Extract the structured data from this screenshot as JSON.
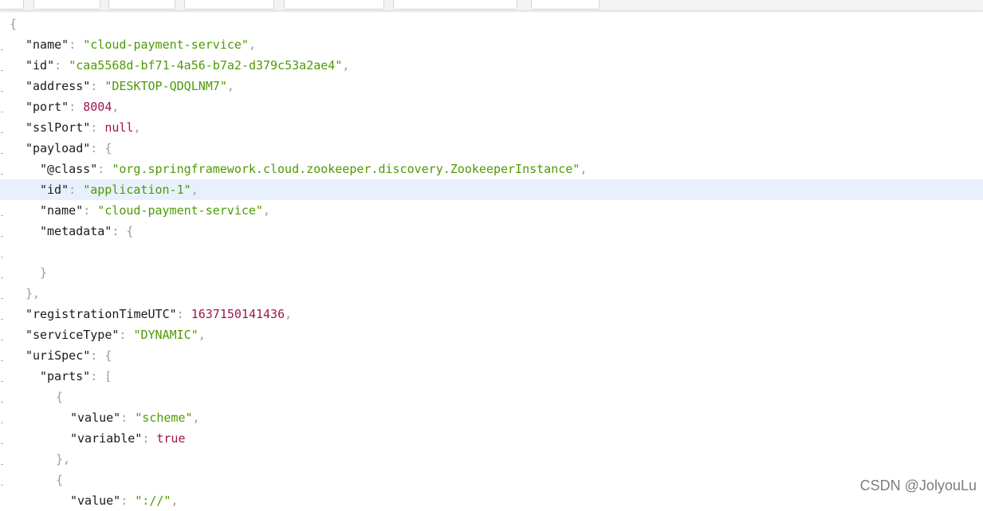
{
  "watermark": "CSDN @JolyouLu",
  "lines": [
    [
      "{"
    ],
    [
      "\"name\"",
      ": ",
      "\"cloud-payment-service\"",
      ","
    ],
    [
      "\"id\"",
      ": ",
      "\"caa5568d-bf71-4a56-b7a2-d379c53a2ae4\"",
      ","
    ],
    [
      "\"address\"",
      ": ",
      "\"DESKTOP-QDQLNM7\"",
      ","
    ],
    [
      "\"port\"",
      ": ",
      "8004",
      ","
    ],
    [
      "\"sslPort\"",
      ": ",
      "null",
      ","
    ],
    [
      "\"payload\"",
      ": ",
      "{"
    ],
    [
      "\"@class\"",
      ": ",
      "\"org.springframework.cloud.zookeeper.discovery.ZookeeperInstance\"",
      ","
    ],
    [
      "\"id\"",
      ": ",
      "\"application-1\"",
      ","
    ],
    [
      "\"name\"",
      ": ",
      "\"cloud-payment-service\"",
      ","
    ],
    [
      "\"metadata\"",
      ": ",
      "{"
    ],
    [
      ""
    ],
    [
      "}"
    ],
    [
      "},"
    ],
    [
      "\"registrationTimeUTC\"",
      ": ",
      "1637150141436",
      ","
    ],
    [
      "\"serviceType\"",
      ": ",
      "\"DYNAMIC\"",
      ","
    ],
    [
      "\"uriSpec\"",
      ": ",
      "{"
    ],
    [
      "\"parts\"",
      ": ",
      "["
    ],
    [
      "{"
    ],
    [
      "\"value\"",
      ": ",
      "\"scheme\"",
      ","
    ],
    [
      "\"variable\"",
      ": ",
      "true"
    ],
    [
      "},"
    ],
    [
      "{"
    ],
    [
      "\"value\"",
      ": ",
      "\"://\"",
      ","
    ]
  ]
}
